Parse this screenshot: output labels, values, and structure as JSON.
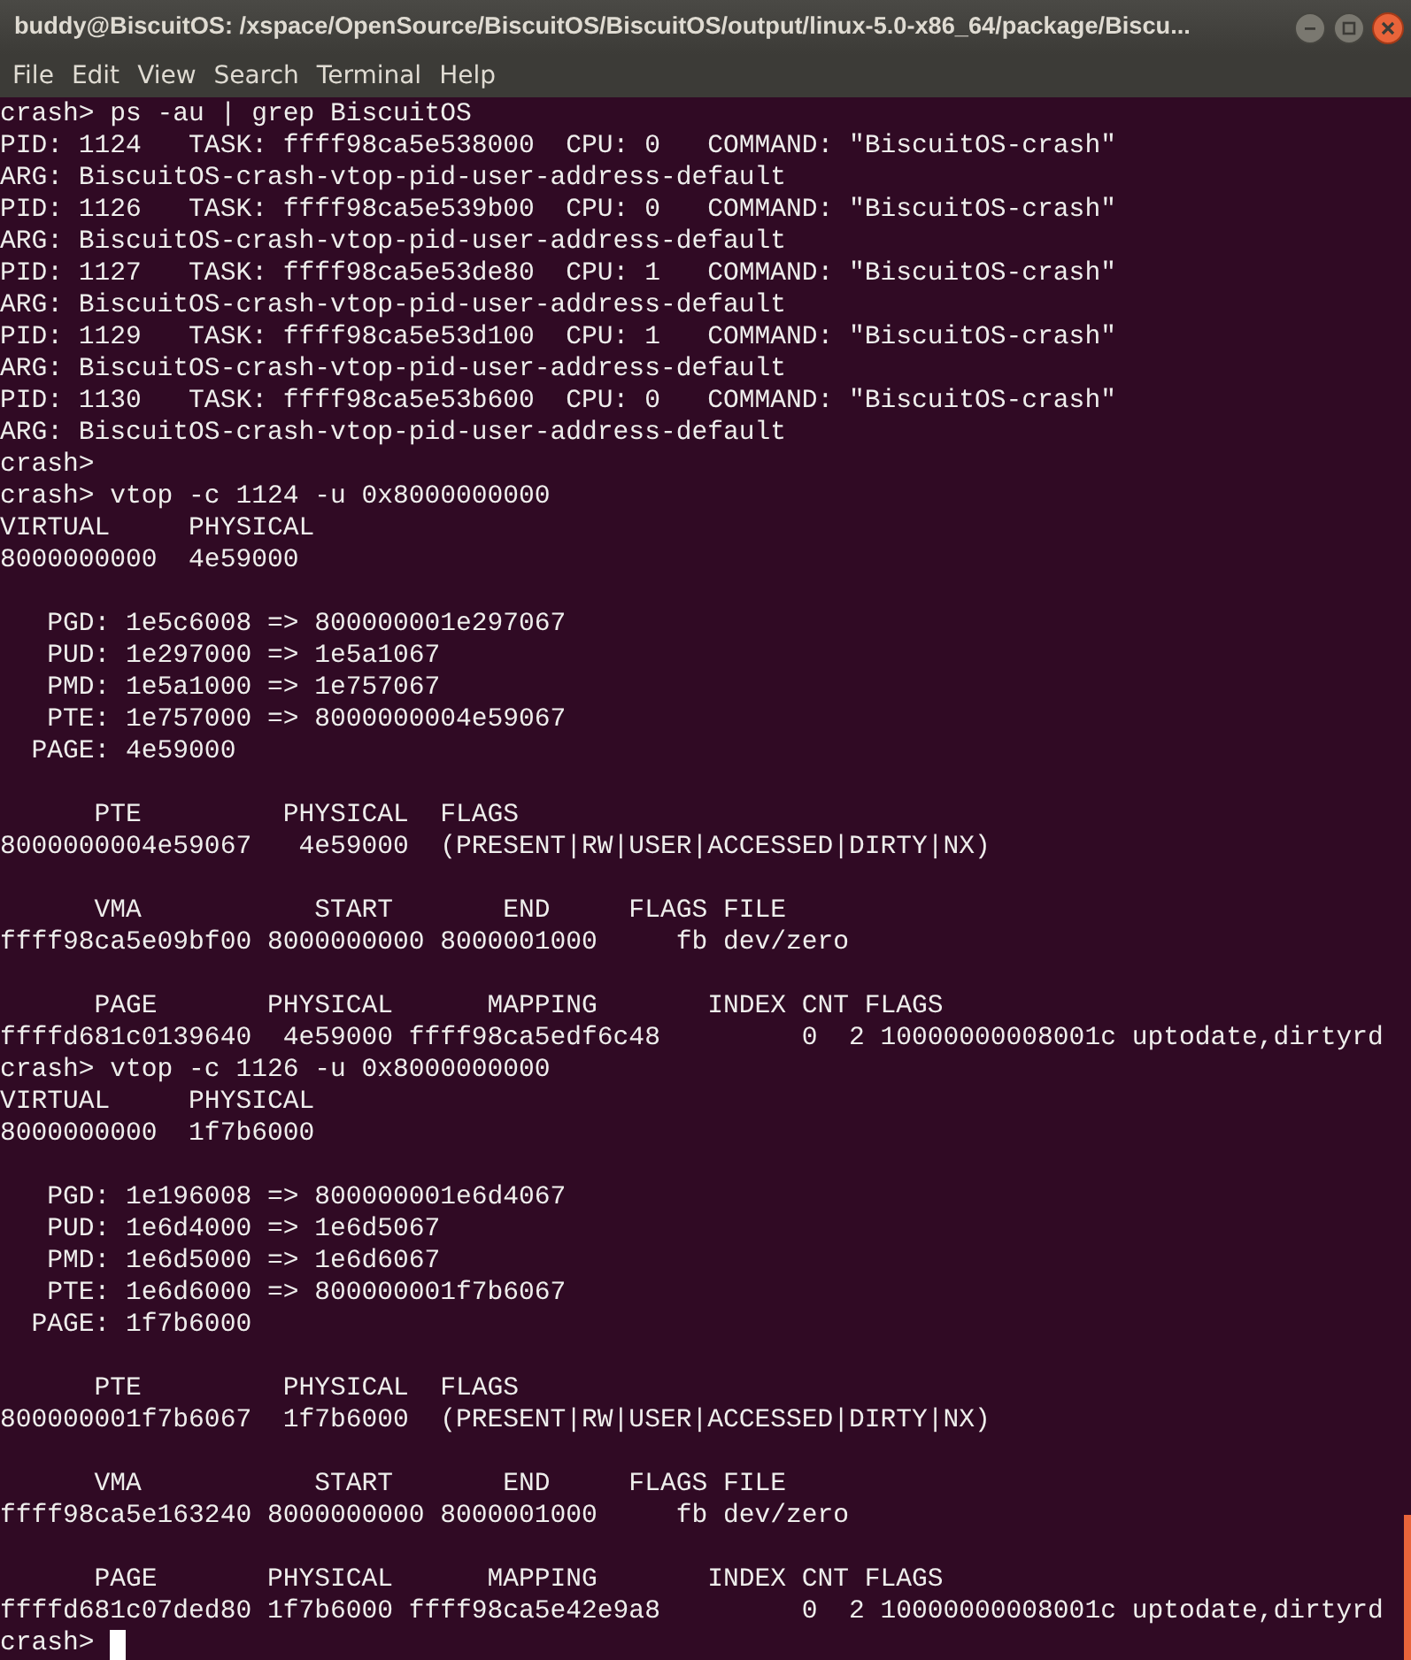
{
  "window": {
    "title": "buddy@BiscuitOS: /xspace/OpenSource/BiscuitOS/BiscuitOS/output/linux-5.0-x86_64/package/Biscu..."
  },
  "menu": [
    "File",
    "Edit",
    "View",
    "Search",
    "Terminal",
    "Help"
  ],
  "terminal": {
    "lines": [
      {
        "kind": "text",
        "text": "crash> ps -au | grep BiscuitOS"
      },
      {
        "kind": "text",
        "text": "PID: 1124   TASK: ffff98ca5e538000  CPU: 0   COMMAND: \"BiscuitOS-crash\""
      },
      {
        "kind": "text",
        "text": "ARG: BiscuitOS-crash-vtop-pid-user-address-default"
      },
      {
        "kind": "text",
        "text": "PID: 1126   TASK: ffff98ca5e539b00  CPU: 0   COMMAND: \"BiscuitOS-crash\""
      },
      {
        "kind": "text",
        "text": "ARG: BiscuitOS-crash-vtop-pid-user-address-default"
      },
      {
        "kind": "text",
        "text": "PID: 1127   TASK: ffff98ca5e53de80  CPU: 1   COMMAND: \"BiscuitOS-crash\""
      },
      {
        "kind": "text",
        "text": "ARG: BiscuitOS-crash-vtop-pid-user-address-default"
      },
      {
        "kind": "text",
        "text": "PID: 1129   TASK: ffff98ca5e53d100  CPU: 1   COMMAND: \"BiscuitOS-crash\""
      },
      {
        "kind": "text",
        "text": "ARG: BiscuitOS-crash-vtop-pid-user-address-default"
      },
      {
        "kind": "text",
        "text": "PID: 1130   TASK: ffff98ca5e53b600  CPU: 0   COMMAND: \"BiscuitOS-crash\""
      },
      {
        "kind": "text",
        "text": "ARG: BiscuitOS-crash-vtop-pid-user-address-default"
      },
      {
        "kind": "text",
        "text": "crash>"
      },
      {
        "kind": "text",
        "text": "crash> vtop -c 1124 -u 0x8000000000"
      },
      {
        "kind": "text",
        "text": "VIRTUAL     PHYSICAL"
      },
      {
        "kind": "text",
        "text": "8000000000  4e59000"
      },
      {
        "kind": "blank"
      },
      {
        "kind": "text",
        "text": "   PGD: 1e5c6008 => 800000001e297067"
      },
      {
        "kind": "text",
        "text": "   PUD: 1e297000 => 1e5a1067"
      },
      {
        "kind": "text",
        "text": "   PMD: 1e5a1000 => 1e757067"
      },
      {
        "kind": "text",
        "text": "   PTE: 1e757000 => 8000000004e59067"
      },
      {
        "kind": "text",
        "text": "  PAGE: 4e59000"
      },
      {
        "kind": "blank"
      },
      {
        "kind": "text",
        "text": "      PTE         PHYSICAL  FLAGS"
      },
      {
        "kind": "text",
        "text": "8000000004e59067   4e59000  (PRESENT|RW|USER|ACCESSED|DIRTY|NX)"
      },
      {
        "kind": "blank"
      },
      {
        "kind": "text",
        "text": "      VMA           START       END     FLAGS FILE"
      },
      {
        "kind": "text",
        "text": "ffff98ca5e09bf00 8000000000 8000001000     fb dev/zero"
      },
      {
        "kind": "blank"
      },
      {
        "kind": "text",
        "text": "      PAGE       PHYSICAL      MAPPING       INDEX CNT FLAGS"
      },
      {
        "kind": "text",
        "text": "ffffd681c0139640  4e59000 ffff98ca5edf6c48         0  2 10000000008001c uptodate,dirtyrd"
      },
      {
        "kind": "text",
        "text": "crash> vtop -c 1126 -u 0x8000000000"
      },
      {
        "kind": "text",
        "text": "VIRTUAL     PHYSICAL"
      },
      {
        "kind": "text",
        "text": "8000000000  1f7b6000"
      },
      {
        "kind": "blank"
      },
      {
        "kind": "text",
        "text": "   PGD: 1e196008 => 800000001e6d4067"
      },
      {
        "kind": "text",
        "text": "   PUD: 1e6d4000 => 1e6d5067"
      },
      {
        "kind": "text",
        "text": "   PMD: 1e6d5000 => 1e6d6067"
      },
      {
        "kind": "text",
        "text": "   PTE: 1e6d6000 => 800000001f7b6067"
      },
      {
        "kind": "text",
        "text": "  PAGE: 1f7b6000"
      },
      {
        "kind": "blank"
      },
      {
        "kind": "text",
        "text": "      PTE         PHYSICAL  FLAGS"
      },
      {
        "kind": "text",
        "text": "800000001f7b6067  1f7b6000  (PRESENT|RW|USER|ACCESSED|DIRTY|NX)"
      },
      {
        "kind": "blank"
      },
      {
        "kind": "text",
        "text": "      VMA           START       END     FLAGS FILE"
      },
      {
        "kind": "text",
        "text": "ffff98ca5e163240 8000000000 8000001000     fb dev/zero"
      },
      {
        "kind": "blank"
      },
      {
        "kind": "text",
        "text": "      PAGE       PHYSICAL      MAPPING       INDEX CNT FLAGS"
      },
      {
        "kind": "text",
        "text": "ffffd681c07ded80 1f7b6000 ffff98ca5e42e9a8         0  2 10000000008001c uptodate,dirtyrd"
      }
    ],
    "prompt": {
      "text": "crash>",
      "cursor": true
    }
  }
}
